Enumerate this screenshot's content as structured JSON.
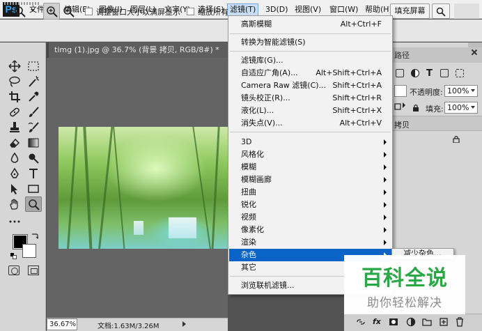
{
  "app": {
    "logo": "Ps",
    "menus": [
      {
        "label": "文件(F)"
      },
      {
        "label": "编辑(E)"
      },
      {
        "label": "图像(I)"
      },
      {
        "label": "图层(L)"
      },
      {
        "label": "文字(Y)"
      },
      {
        "label": "选择(S)"
      },
      {
        "label": "滤镜(T)"
      },
      {
        "label": "3D(D)"
      },
      {
        "label": "视图(V)"
      },
      {
        "label": "窗口(W)"
      },
      {
        "label": "帮助(H)"
      }
    ],
    "active_menu": "滤镜(T)"
  },
  "options_bar": {
    "resize_windows_label": "调整窗口大小以满屏显示",
    "zoom_all_label": "缩放所有",
    "fill_screen_label": "填充屏幕"
  },
  "document": {
    "tab_title": "timg (1).jpg @ 36.7% (背景 拷贝, RGB/8#) *",
    "zoom": "36.67%",
    "doc_size": "文档:1.63M/3.26M"
  },
  "filter_menu": {
    "items": [
      {
        "label": "高斯模糊",
        "shortcut": "Alt+Ctrl+F",
        "submenu": false
      },
      {
        "label": "转换为智能滤镜(S)",
        "shortcut": "",
        "submenu": false
      },
      {
        "label": "滤镜库(G)...",
        "shortcut": "",
        "submenu": false
      },
      {
        "label": "自适应广角(A)...",
        "shortcut": "Alt+Shift+Ctrl+A",
        "submenu": false
      },
      {
        "label": "Camera Raw 滤镜(C)...",
        "shortcut": "Shift+Ctrl+A",
        "submenu": false
      },
      {
        "label": "镜头校正(R)...",
        "shortcut": "Shift+Ctrl+R",
        "submenu": false
      },
      {
        "label": "液化(L)...",
        "shortcut": "Shift+Ctrl+X",
        "submenu": false
      },
      {
        "label": "消失点(V)...",
        "shortcut": "Alt+Ctrl+V",
        "submenu": false
      },
      {
        "label": "3D",
        "shortcut": "",
        "submenu": true
      },
      {
        "label": "风格化",
        "shortcut": "",
        "submenu": true
      },
      {
        "label": "模糊",
        "shortcut": "",
        "submenu": true
      },
      {
        "label": "模糊画廊",
        "shortcut": "",
        "submenu": true
      },
      {
        "label": "扭曲",
        "shortcut": "",
        "submenu": true
      },
      {
        "label": "锐化",
        "shortcut": "",
        "submenu": true
      },
      {
        "label": "视频",
        "shortcut": "",
        "submenu": true
      },
      {
        "label": "像素化",
        "shortcut": "",
        "submenu": true
      },
      {
        "label": "渲染",
        "shortcut": "",
        "submenu": true
      },
      {
        "label": "杂色",
        "shortcut": "",
        "submenu": true,
        "highlighted": true
      },
      {
        "label": "其它",
        "shortcut": "",
        "submenu": true
      },
      {
        "label": "浏览联机滤镜...",
        "shortcut": "",
        "submenu": false
      }
    ],
    "submenu_first_item": "减少杂色..."
  },
  "layers_panel": {
    "tab_label": "路径",
    "opacity_label": "不透明度:",
    "opacity_value": "100%",
    "fill_label": "填充:",
    "fill_value": "100%",
    "layer_name": "拷贝"
  },
  "watermark": {
    "title": "百科全说",
    "subtitle": "助你轻松解决"
  },
  "colors": {
    "menu_highlight": "#0a64c8",
    "watermark_green": "#2aa845",
    "ps_blue": "#31a8ff"
  }
}
